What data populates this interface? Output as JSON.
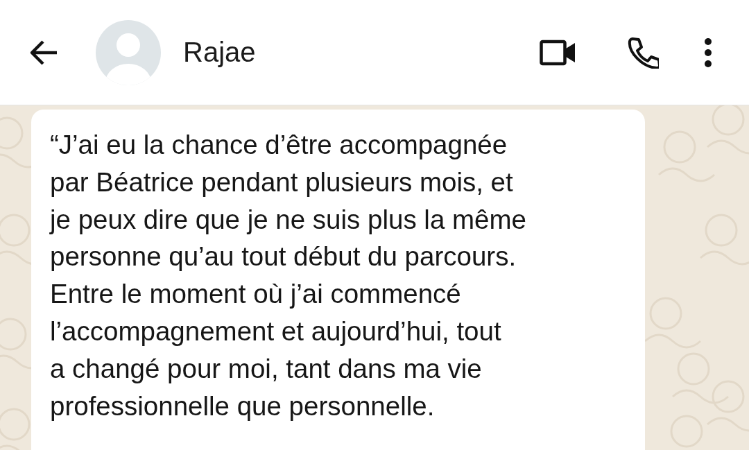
{
  "header": {
    "contact_name": "Rajae"
  },
  "message": {
    "text": "“J’ai eu la chance d’être accompagnée\npar Béatrice pendant plusieurs mois, et\nje peux dire que je ne suis plus la même\npersonne qu’au tout début du parcours.\nEntre le moment où j’ai commencé\nl’accompagnement et aujourd’hui, tout\na changé pour moi, tant dans ma vie\nprofessionnelle que personnelle."
  }
}
